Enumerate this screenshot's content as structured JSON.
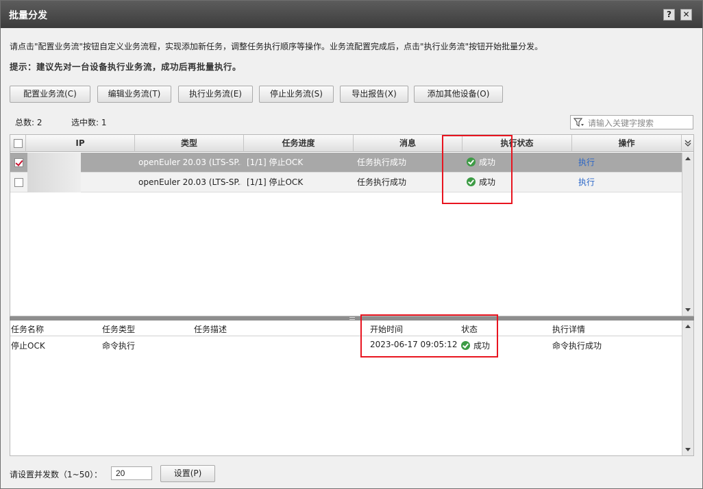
{
  "window": {
    "title": "批量分发",
    "help_label": "?",
    "close_label": "✕"
  },
  "intro": "请点击\"配置业务流\"按钮自定义业务流程，实现添加新任务，调整任务执行顺序等操作。业务流配置完成后，点击\"执行业务流\"按钮开始批量分发。",
  "tip": "提示：建议先对一台设备执行业务流，成功后再批量执行。",
  "toolbar": {
    "configure": "配置业务流(C)",
    "edit": "编辑业务流(T)",
    "execute": "执行业务流(E)",
    "stop": "停止业务流(S)",
    "export": "导出报告(X)",
    "add_device": "添加其他设备(O)"
  },
  "stats": {
    "total": "总数: 2",
    "selected": "选中数: 1"
  },
  "search": {
    "placeholder": "请输入关键字搜索"
  },
  "device_table": {
    "headers": {
      "ip": "IP",
      "type": "类型",
      "progress": "任务进度",
      "message": "消息",
      "status": "执行状态",
      "action": "操作"
    },
    "rows": [
      {
        "checked": true,
        "type": "openEuler 20.03 (LTS-SP...",
        "progress": "[1/1] 停止OCK",
        "message": "任务执行成功",
        "status": "成功",
        "action": "执行"
      },
      {
        "checked": false,
        "type": "openEuler 20.03 (LTS-SP...",
        "progress": "[1/1] 停止OCK",
        "message": "任务执行成功",
        "status": "成功",
        "action": "执行"
      }
    ]
  },
  "task_table": {
    "headers": {
      "name": "任务名称",
      "type": "任务类型",
      "desc": "任务描述",
      "start": "开始时间",
      "status": "状态",
      "detail": "执行详情"
    },
    "rows": [
      {
        "name": "停止OCK",
        "type": "命令执行",
        "desc": "",
        "start": "2023-06-17 09:05:12",
        "status": "成功",
        "detail": "命令执行成功"
      }
    ]
  },
  "concurrency": {
    "label": "请设置并发数（1~50）：",
    "value": "20",
    "set_button": "设置(P)"
  },
  "colors": {
    "titlebar": "#4a4a4a",
    "selected_row": "#a8a8a8",
    "success": "#3d9b45",
    "link": "#2a66c7",
    "highlight": "#e8141f"
  }
}
